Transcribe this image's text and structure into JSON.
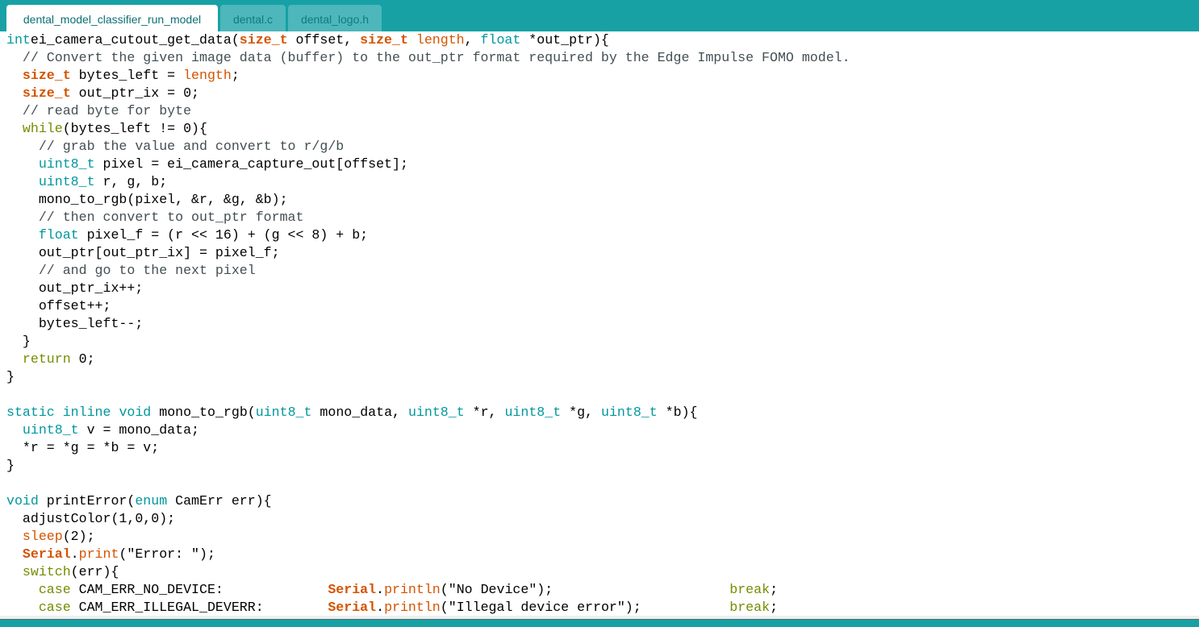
{
  "tabs": [
    {
      "label": "dental_model_classifier_run_model",
      "active": true
    },
    {
      "label": "dental.c",
      "active": false
    },
    {
      "label": "dental_logo.h",
      "active": false
    }
  ],
  "colors": {
    "accent": "#17A1A5",
    "inactive_tab": "#4DB7BB",
    "type_keyword": "#00979D",
    "control_keyword": "#728E00",
    "builtin": "#D35400",
    "comment": "#434F54",
    "string": "#005C5F"
  },
  "code_lines": [
    [
      [
        "type",
        "int"
      ],
      [
        "",
        "ei_camera_cutout_get_data("
      ],
      [
        "bold",
        "size_t"
      ],
      [
        "",
        " offset, "
      ],
      [
        "bold",
        "size_t"
      ],
      [
        "",
        " "
      ],
      [
        "fn",
        "length"
      ],
      [
        "",
        ", "
      ],
      [
        "type",
        "float"
      ],
      [
        "",
        " *out_ptr){"
      ]
    ],
    [
      [
        "",
        "  "
      ],
      [
        "cmt",
        "// Convert the given image data (buffer) to the out_ptr format required by the Edge Impulse FOMO model."
      ]
    ],
    [
      [
        "",
        "  "
      ],
      [
        "bold",
        "size_t"
      ],
      [
        "",
        " bytes_left = "
      ],
      [
        "fn",
        "length"
      ],
      [
        "",
        ";"
      ]
    ],
    [
      [
        "",
        "  "
      ],
      [
        "bold",
        "size_t"
      ],
      [
        "",
        " out_ptr_ix = 0;"
      ]
    ],
    [
      [
        "",
        "  "
      ],
      [
        "cmt",
        "// read byte for byte"
      ]
    ],
    [
      [
        "",
        "  "
      ],
      [
        "ctrl",
        "while"
      ],
      [
        "",
        "(bytes_left != 0){"
      ]
    ],
    [
      [
        "",
        "    "
      ],
      [
        "cmt",
        "// grab the value and convert to r/g/b"
      ]
    ],
    [
      [
        "",
        "    "
      ],
      [
        "type",
        "uint8_t"
      ],
      [
        "",
        " pixel = ei_camera_capture_out[offset];"
      ]
    ],
    [
      [
        "",
        "    "
      ],
      [
        "type",
        "uint8_t"
      ],
      [
        "",
        " r, g, b;"
      ]
    ],
    [
      [
        "",
        "    mono_to_rgb(pixel, &r, &g, &b);"
      ]
    ],
    [
      [
        "",
        "    "
      ],
      [
        "cmt",
        "// then convert to out_ptr format"
      ]
    ],
    [
      [
        "",
        "    "
      ],
      [
        "type",
        "float"
      ],
      [
        "",
        " pixel_f = (r << 16) + (g << 8) + b;"
      ]
    ],
    [
      [
        "",
        "    out_ptr[out_ptr_ix] = pixel_f;"
      ]
    ],
    [
      [
        "",
        "    "
      ],
      [
        "cmt",
        "// and go to the next pixel"
      ]
    ],
    [
      [
        "",
        "    out_ptr_ix++;"
      ]
    ],
    [
      [
        "",
        "    offset++;"
      ]
    ],
    [
      [
        "",
        "    bytes_left--;"
      ]
    ],
    [
      [
        "",
        "  }"
      ]
    ],
    [
      [
        "",
        "  "
      ],
      [
        "ctrl",
        "return"
      ],
      [
        "",
        " 0;"
      ]
    ],
    [
      [
        "",
        "}"
      ]
    ],
    [
      [
        "",
        ""
      ]
    ],
    [
      [
        "type",
        "static"
      ],
      [
        "",
        " "
      ],
      [
        "type",
        "inline"
      ],
      [
        "",
        " "
      ],
      [
        "type",
        "void"
      ],
      [
        "",
        " mono_to_rgb("
      ],
      [
        "type",
        "uint8_t"
      ],
      [
        "",
        " mono_data, "
      ],
      [
        "type",
        "uint8_t"
      ],
      [
        "",
        " *r, "
      ],
      [
        "type",
        "uint8_t"
      ],
      [
        "",
        " *g, "
      ],
      [
        "type",
        "uint8_t"
      ],
      [
        "",
        " *b){"
      ]
    ],
    [
      [
        "",
        "  "
      ],
      [
        "type",
        "uint8_t"
      ],
      [
        "",
        " v = mono_data;"
      ]
    ],
    [
      [
        "",
        "  *r = *g = *b = v;"
      ]
    ],
    [
      [
        "",
        "}"
      ]
    ],
    [
      [
        "",
        ""
      ]
    ],
    [
      [
        "type",
        "void"
      ],
      [
        "",
        " printError("
      ],
      [
        "type",
        "enum"
      ],
      [
        "",
        " CamErr err){"
      ]
    ],
    [
      [
        "",
        "  adjustColor(1,0,0);"
      ]
    ],
    [
      [
        "",
        "  "
      ],
      [
        "fn",
        "sleep"
      ],
      [
        "",
        "(2);"
      ]
    ],
    [
      [
        "",
        "  "
      ],
      [
        "bold",
        "Serial"
      ],
      [
        "",
        "."
      ],
      [
        "fn",
        "print"
      ],
      [
        "",
        "(\"Error: \");"
      ]
    ],
    [
      [
        "",
        "  "
      ],
      [
        "ctrl",
        "switch"
      ],
      [
        "",
        "(err){"
      ]
    ],
    [
      [
        "",
        "    "
      ],
      [
        "ctrl",
        "case"
      ],
      [
        "",
        " CAM_ERR_NO_DEVICE:             "
      ],
      [
        "bold",
        "Serial"
      ],
      [
        "",
        "."
      ],
      [
        "fn",
        "println"
      ],
      [
        "",
        "(\"No Device\");                      "
      ],
      [
        "ctrl",
        "break"
      ],
      [
        "",
        ";"
      ]
    ],
    [
      [
        "",
        "    "
      ],
      [
        "ctrl",
        "case"
      ],
      [
        "",
        " CAM_ERR_ILLEGAL_DEVERR:        "
      ],
      [
        "bold",
        "Serial"
      ],
      [
        "",
        "."
      ],
      [
        "fn",
        "println"
      ],
      [
        "",
        "(\"Illegal device error\");           "
      ],
      [
        "ctrl",
        "break"
      ],
      [
        "",
        ";"
      ]
    ]
  ]
}
